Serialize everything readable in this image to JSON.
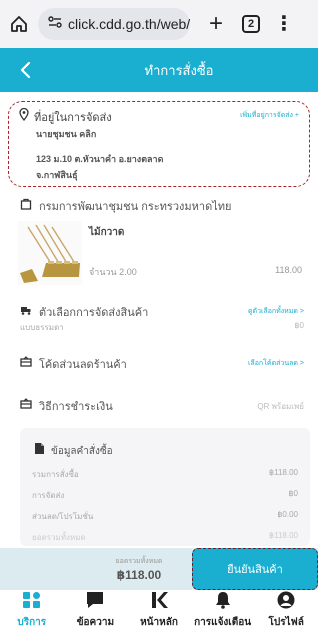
{
  "browser": {
    "url": "click.cdd.go.th/web/",
    "tab_count": "2"
  },
  "header": {
    "title": "ทำการสั่งซื้อ"
  },
  "address": {
    "title": "ที่อยู่ในการจัดส่ง",
    "add_link": "เพิ่มที่อยู่การจัดส่ง +",
    "name": "นายชุมชน คลิก",
    "line1": "123 ม.10 ต.หัวนาคำ อ.ยางตลาด",
    "line2": "จ.กาฬสินธุ์"
  },
  "shop": {
    "name": "กรมการพัฒนาชุมชน กระทรวงมหาดไทย"
  },
  "product": {
    "name": "ไม้กวาด",
    "quantity": "จำนวน 2.00",
    "price": "118.00"
  },
  "shipping": {
    "title": "ตัวเลือกการจัดส่งสินค้า",
    "link": "ดูตัวเลือกทั้งหมด >",
    "method": "แบบธรรมดา",
    "cost": "฿0"
  },
  "discount": {
    "title": "โค้ดส่วนลดร้านค้า",
    "link": "เลือกโค้ดส่วนลด >"
  },
  "payment": {
    "title": "วิธีการชำระเงิน",
    "method": "QR พร้อมเพย์"
  },
  "summary": {
    "title": "ข้อมูลคำสั่งซื้อ",
    "rows": [
      {
        "label": "รวมการสั่งซื้อ",
        "value": "฿118.00"
      },
      {
        "label": "การจัดส่ง",
        "value": "฿0"
      },
      {
        "label": "ส่วนลด/โปรโมชั่น",
        "value": "฿0.00"
      },
      {
        "label": "ยอดรวมทั้งหมด",
        "value": "฿118.00"
      }
    ]
  },
  "checkout": {
    "total_label": "ยอดรวมทั้งหมด",
    "total_value": "฿118.00",
    "confirm_label": "ยืนยันสินค้า"
  },
  "nav": [
    {
      "label": "บริการ",
      "icon": "services-icon",
      "active": true
    },
    {
      "label": "ข้อความ",
      "icon": "message-icon",
      "active": false
    },
    {
      "label": "หน้าหลัก",
      "icon": "home-logo-icon",
      "active": false
    },
    {
      "label": "การแจ้งเตือน",
      "icon": "bell-icon",
      "active": false
    },
    {
      "label": "โปรไฟล์",
      "icon": "profile-icon",
      "active": false
    }
  ],
  "colors": {
    "accent": "#1aaed1",
    "highlight_border": "#a8232b"
  }
}
